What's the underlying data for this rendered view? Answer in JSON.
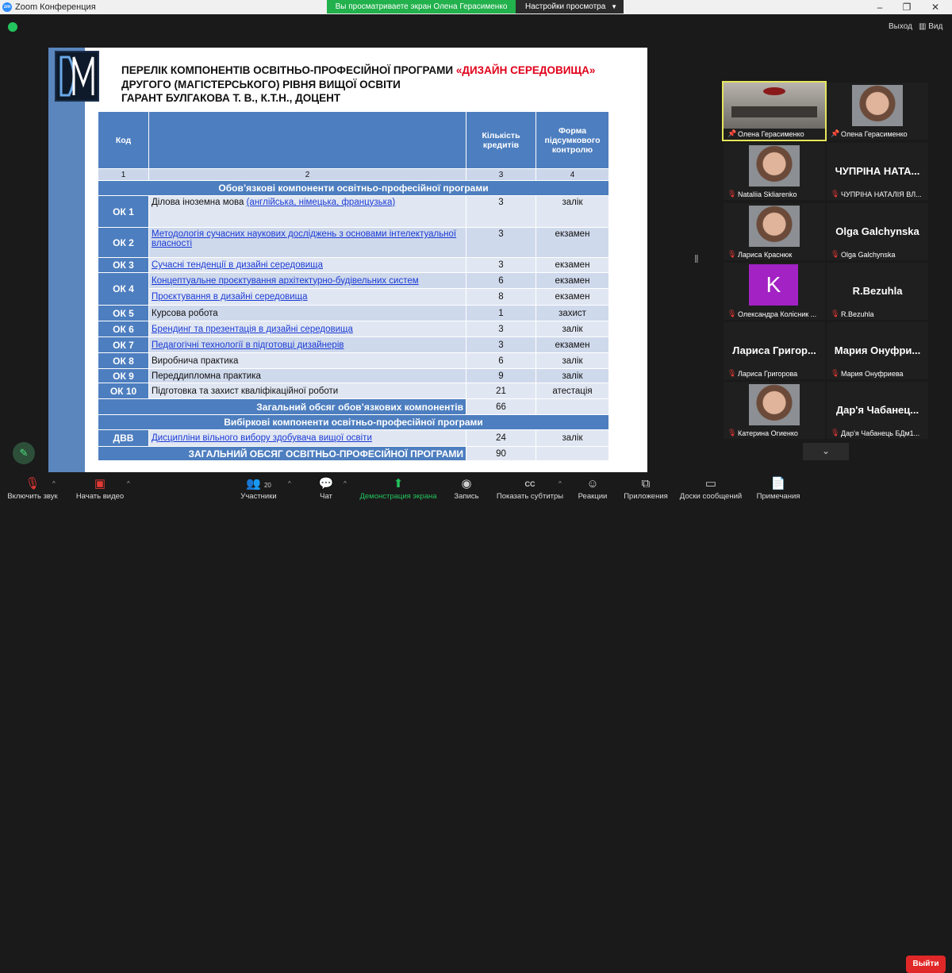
{
  "window": {
    "title": "Zoom Конференция",
    "app_icon": "zm",
    "share_banner": "Вы просматриваете экран Олена Герасименко",
    "view_options": "Настройки просмотра",
    "exit": "Выход",
    "view": "Вид"
  },
  "slide": {
    "heading_line1_prefix": "ПЕРЕЛІК КОМПОНЕНТІВ ОСВІТНЬО-ПРОФЕСІЙНОЇ ПРОГРАМИ",
    "heading_line1_highlight": "«ДИЗАЙН СЕРЕДОВИЩА»",
    "heading_line2": "ДРУГОГО (МАГІСТЕРСЬКОГО) РІВНЯ ВИЩОЇ ОСВІТИ",
    "heading_line3": "ГАРАНТ БУЛГАКОВА Т. В., К.Т.Н., ДОЦЕНТ",
    "table": {
      "headers": [
        "Код",
        "",
        "Кількість кредитів",
        "Форма підсумкового контролю"
      ],
      "col_numbers": [
        "1",
        "2",
        "3",
        "4"
      ],
      "section1": "Обов’язкові компоненти освітньо-професійної програми",
      "rows": [
        {
          "code": "ОК 1",
          "name_plain": "Ділова іноземна мова ",
          "name_link": "(англійська, німецька, французька)",
          "credits": "3",
          "form": "залік"
        },
        {
          "code": "ОК 2",
          "name_plain": "",
          "name_link": "Методологія сучасних наукових досліджень з основами інтелектуальної власності",
          "credits": "3",
          "form": "екзамен"
        },
        {
          "code": "ОК 3",
          "name_plain": "",
          "name_link": "Сучасні тенденції в дизайні середовища",
          "credits": "3",
          "form": "екзамен"
        },
        {
          "code": "ОК 4",
          "name_plain": "",
          "name_link": "Концептуальне проєктування архітектурно-будівельних систем",
          "credits": "6",
          "form": "екзамен"
        },
        {
          "code": "",
          "name_plain": "",
          "name_link": "Проєктування в дизайні середовища",
          "credits": "8",
          "form": "екзамен"
        },
        {
          "code": "ОК 5",
          "name_plain": "Курсова робота",
          "name_link": "",
          "credits": "1",
          "form": "захист"
        },
        {
          "code": "ОК 6",
          "name_plain": "",
          "name_link": "Брендинг та презентація в дизайні середовища",
          "credits": "3",
          "form": "залік"
        },
        {
          "code": "ОК 7",
          "name_plain": "",
          "name_link": "Педагогічні технології в підготовці дизайнерів",
          "credits": "3",
          "form": "екзамен"
        },
        {
          "code": "ОК 8",
          "name_plain": "Виробнича практика",
          "name_link": "",
          "credits": "6",
          "form": "залік"
        },
        {
          "code": "ОК 9",
          "name_plain": "Переддипломна практика",
          "name_link": "",
          "credits": "9",
          "form": "залік"
        },
        {
          "code": "ОК 10",
          "name_plain": "Підготовка та захист кваліфікаційної роботи",
          "name_link": "",
          "credits": "21",
          "form": "атестація"
        }
      ],
      "total1_label": "Загальний обсяг обов’язкових компонентів",
      "total1_value": "66",
      "section2": "Вибіркові компоненти освітньо-професійної програми",
      "elective": {
        "code": "ДВВ",
        "name_link": "Дисципліни вільного вибору здобувача вищої освіти",
        "credits": "24",
        "form": "залік"
      },
      "total2_label": "ЗАГАЛЬНИЙ ОБСЯГ ОСВІТНЬО-ПРОФЕСІЙНОЇ ПРОГРАМИ",
      "total2_value": "90"
    }
  },
  "participants": [
    {
      "name": "Олена Герасименко",
      "big": "",
      "kind": "video-room",
      "muted": false,
      "active": true
    },
    {
      "name": "Олена Герасименко",
      "big": "",
      "kind": "video-face",
      "muted": false
    },
    {
      "name": "Nataliia Skliarenko",
      "big": "",
      "kind": "video-face",
      "muted": true
    },
    {
      "name": "ЧУПРІНА НАТАЛІЯ ВЛ...",
      "big": "ЧУПРІНА НАТА...",
      "kind": "name",
      "muted": true
    },
    {
      "name": "Лариса Краснюк",
      "big": "",
      "kind": "video-face",
      "muted": true
    },
    {
      "name": "Olga Galchynska",
      "big": "Olga Galchynska",
      "kind": "name",
      "muted": true
    },
    {
      "name": "Олександра Колісник ...",
      "big": "",
      "kind": "avatar",
      "avatar": "K",
      "muted": true
    },
    {
      "name": "R.Bezuhla",
      "big": "R.Bezuhla",
      "kind": "name",
      "muted": true
    },
    {
      "name": "Лариса Григорова",
      "big": "Лариса Григор...",
      "kind": "name",
      "muted": true
    },
    {
      "name": "Мария Онуфриева",
      "big": "Мария Онуфри...",
      "kind": "name",
      "muted": true
    },
    {
      "name": "Катерина Огиенко",
      "big": "",
      "kind": "video-face",
      "muted": true
    },
    {
      "name": "Дар'я Чабанець БДм1...",
      "big": "Дар'я Чабанец...",
      "kind": "name",
      "muted": true
    }
  ],
  "toolbar": {
    "unmute": "Включить звук",
    "start_video": "Начать видео",
    "participants": "Участники",
    "participants_count": "20",
    "chat": "Чат",
    "share": "Демонстрация экрана",
    "record": "Запись",
    "captions": "Показать субтитры",
    "captions_icon": "CC",
    "reactions": "Реакции",
    "apps": "Приложения",
    "whiteboards": "Доски сообщений",
    "notes": "Примечания",
    "leave": "Выйти"
  }
}
